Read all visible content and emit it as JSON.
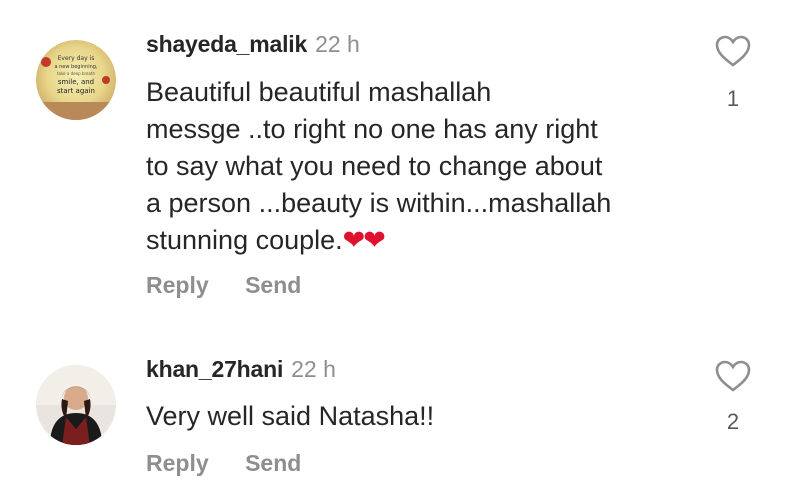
{
  "comments": [
    {
      "username": "shayeda_malik",
      "time": "22 h",
      "text": "Beautiful  beautiful  mashallah\nmessge ..to right no one has any right\nto say what you need to  change about\na person ...beauty is within...mashallah\nstunning couple.",
      "emoji": "❤❤",
      "avatar_text": "Every day is a new beginning, take a deep breath, smile, and start again",
      "reply_label": "Reply",
      "send_label": "Send",
      "like_count": "1"
    },
    {
      "username": "khan_27hani",
      "time": "22 h",
      "text": "Very well said Natasha!!",
      "reply_label": "Reply",
      "send_label": "Send",
      "like_count": "2"
    }
  ],
  "colors": {
    "heart_emoji": "#e0102f",
    "secondary_text": "#8e8e8e",
    "primary_text": "#262626"
  }
}
